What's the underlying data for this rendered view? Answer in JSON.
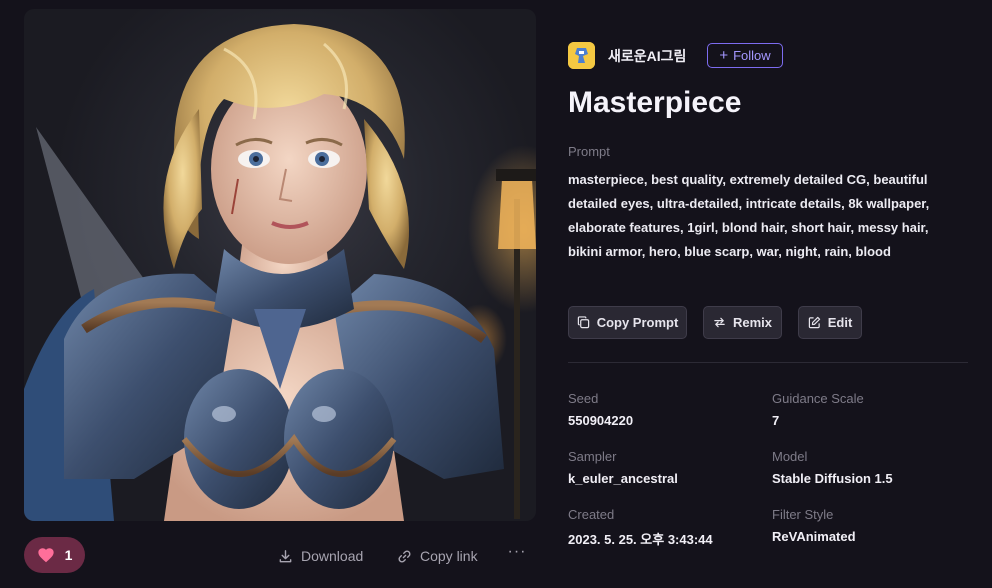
{
  "image": {
    "alt_icon": "artwork-image"
  },
  "actions": {
    "like_count": "1",
    "download_label": "Download",
    "copy_link_label": "Copy link",
    "more_label": "···"
  },
  "author": {
    "name": "새로운AI그림",
    "follow_label": "Follow"
  },
  "artwork": {
    "title": "Masterpiece",
    "prompt_label": "Prompt",
    "prompt": "masterpiece, best quality, extremely detailed CG, beautiful detailed eyes, ultra-detailed, intricate details, 8k wallpaper, elaborate features, 1girl, blond hair, short hair, messy hair, bikini armor, hero, blue scarp, war, night, rain, blood"
  },
  "buttons": {
    "copy_prompt": "Copy Prompt",
    "remix": "Remix",
    "edit": "Edit"
  },
  "meta": {
    "seed_label": "Seed",
    "seed": "550904220",
    "guidance_label": "Guidance Scale",
    "guidance": "7",
    "sampler_label": "Sampler",
    "sampler": "k_euler_ancestral",
    "model_label": "Model",
    "model": "Stable Diffusion 1.5",
    "created_label": "Created",
    "created": "2023. 5. 25. 오후 3:43:44",
    "filter_label": "Filter Style",
    "filter": "ReVAnimated"
  },
  "colors": {
    "background": "#14121b",
    "accent": "#7d6cf0",
    "like_bg": "#6b2a45",
    "heart": "#ff6f9a"
  }
}
